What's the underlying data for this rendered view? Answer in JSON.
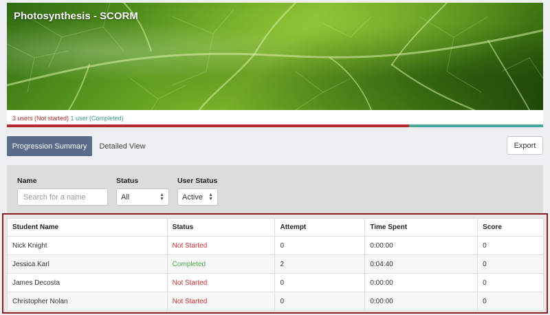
{
  "course": {
    "title": "Photosynthesis - SCORM",
    "not_started_label": "3 users (Not started)",
    "completed_label": "1 user (Completed)",
    "progress": {
      "not_started_fraction": 0.75,
      "completed_fraction": 0.25
    },
    "colors": {
      "not_started": "#b02a2e",
      "completed": "#4aa89a"
    }
  },
  "tabs": [
    {
      "label": "Progression Summary",
      "active": true
    },
    {
      "label": "Detailed View",
      "active": false
    }
  ],
  "export_label": "Export",
  "filters": {
    "name": {
      "label": "Name",
      "placeholder": "Search for a name"
    },
    "status": {
      "label": "Status",
      "value": "All"
    },
    "user_status": {
      "label": "User Status",
      "value": "Active"
    }
  },
  "table": {
    "columns": [
      "Student Name",
      "Status",
      "Attempt",
      "Time Spent",
      "Score"
    ],
    "rows": [
      {
        "name": "Nick Knight",
        "status": "Not Started",
        "attempt": "0",
        "time": "0:00:00",
        "score": "0"
      },
      {
        "name": "Jessica Karl",
        "status": "Completed",
        "attempt": "2",
        "time": "0:04:40",
        "score": "0"
      },
      {
        "name": "James Decosta",
        "status": "Not Started",
        "attempt": "0",
        "time": "0:00:00",
        "score": "0"
      },
      {
        "name": "Christopher Nolan",
        "status": "Not Started",
        "attempt": "0",
        "time": "0:00:00",
        "score": "0"
      }
    ]
  }
}
